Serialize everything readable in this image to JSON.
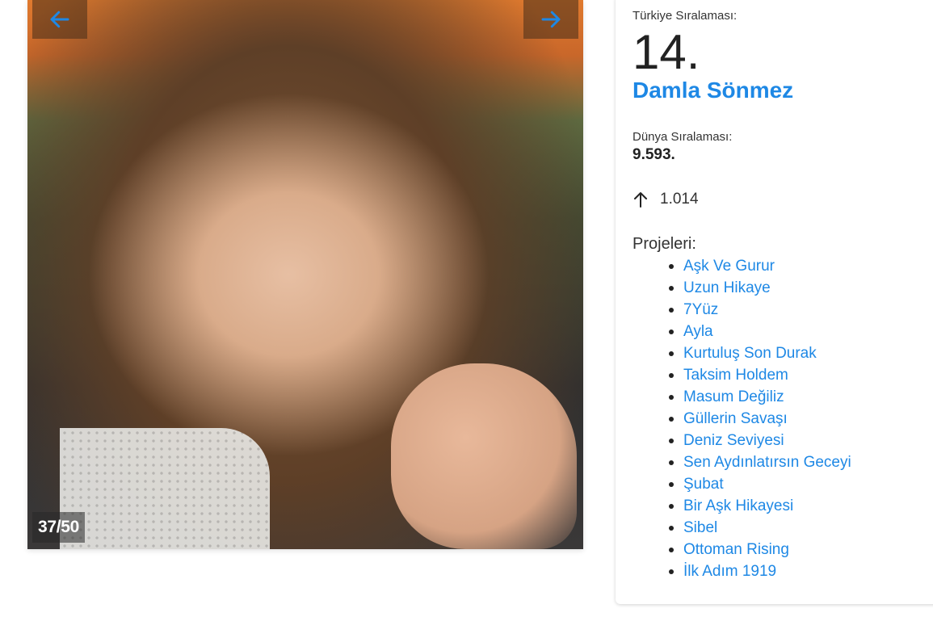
{
  "gallery": {
    "counter": "37/50",
    "prev_icon": "arrow-left-icon",
    "next_icon": "arrow-right-icon",
    "arrow_color": "#1e88e5"
  },
  "profile": {
    "turkey_rank_label": "Türkiye Sıralaması:",
    "turkey_rank": "14.",
    "name": "Damla Sönmez",
    "world_rank_label": "Dünya Sıralaması:",
    "world_rank": "9.593.",
    "change_icon": "arrow-up-icon",
    "change_value": "1.014",
    "projects_label": "Projeleri:",
    "projects": [
      "Aşk Ve Gurur",
      "Uzun Hikaye",
      "7Yüz",
      "Ayla",
      "Kurtuluş Son Durak",
      "Taksim Holdem",
      "Masum Değiliz",
      "Güllerin Savaşı",
      "Deniz Seviyesi",
      "Sen Aydınlatırsın Geceyi",
      "Şubat",
      "Bir Aşk Hikayesi",
      "Sibel",
      "Ottoman Rising",
      "İlk Adım 1919"
    ]
  },
  "colors": {
    "link": "#1e88e5",
    "text": "#222222"
  }
}
